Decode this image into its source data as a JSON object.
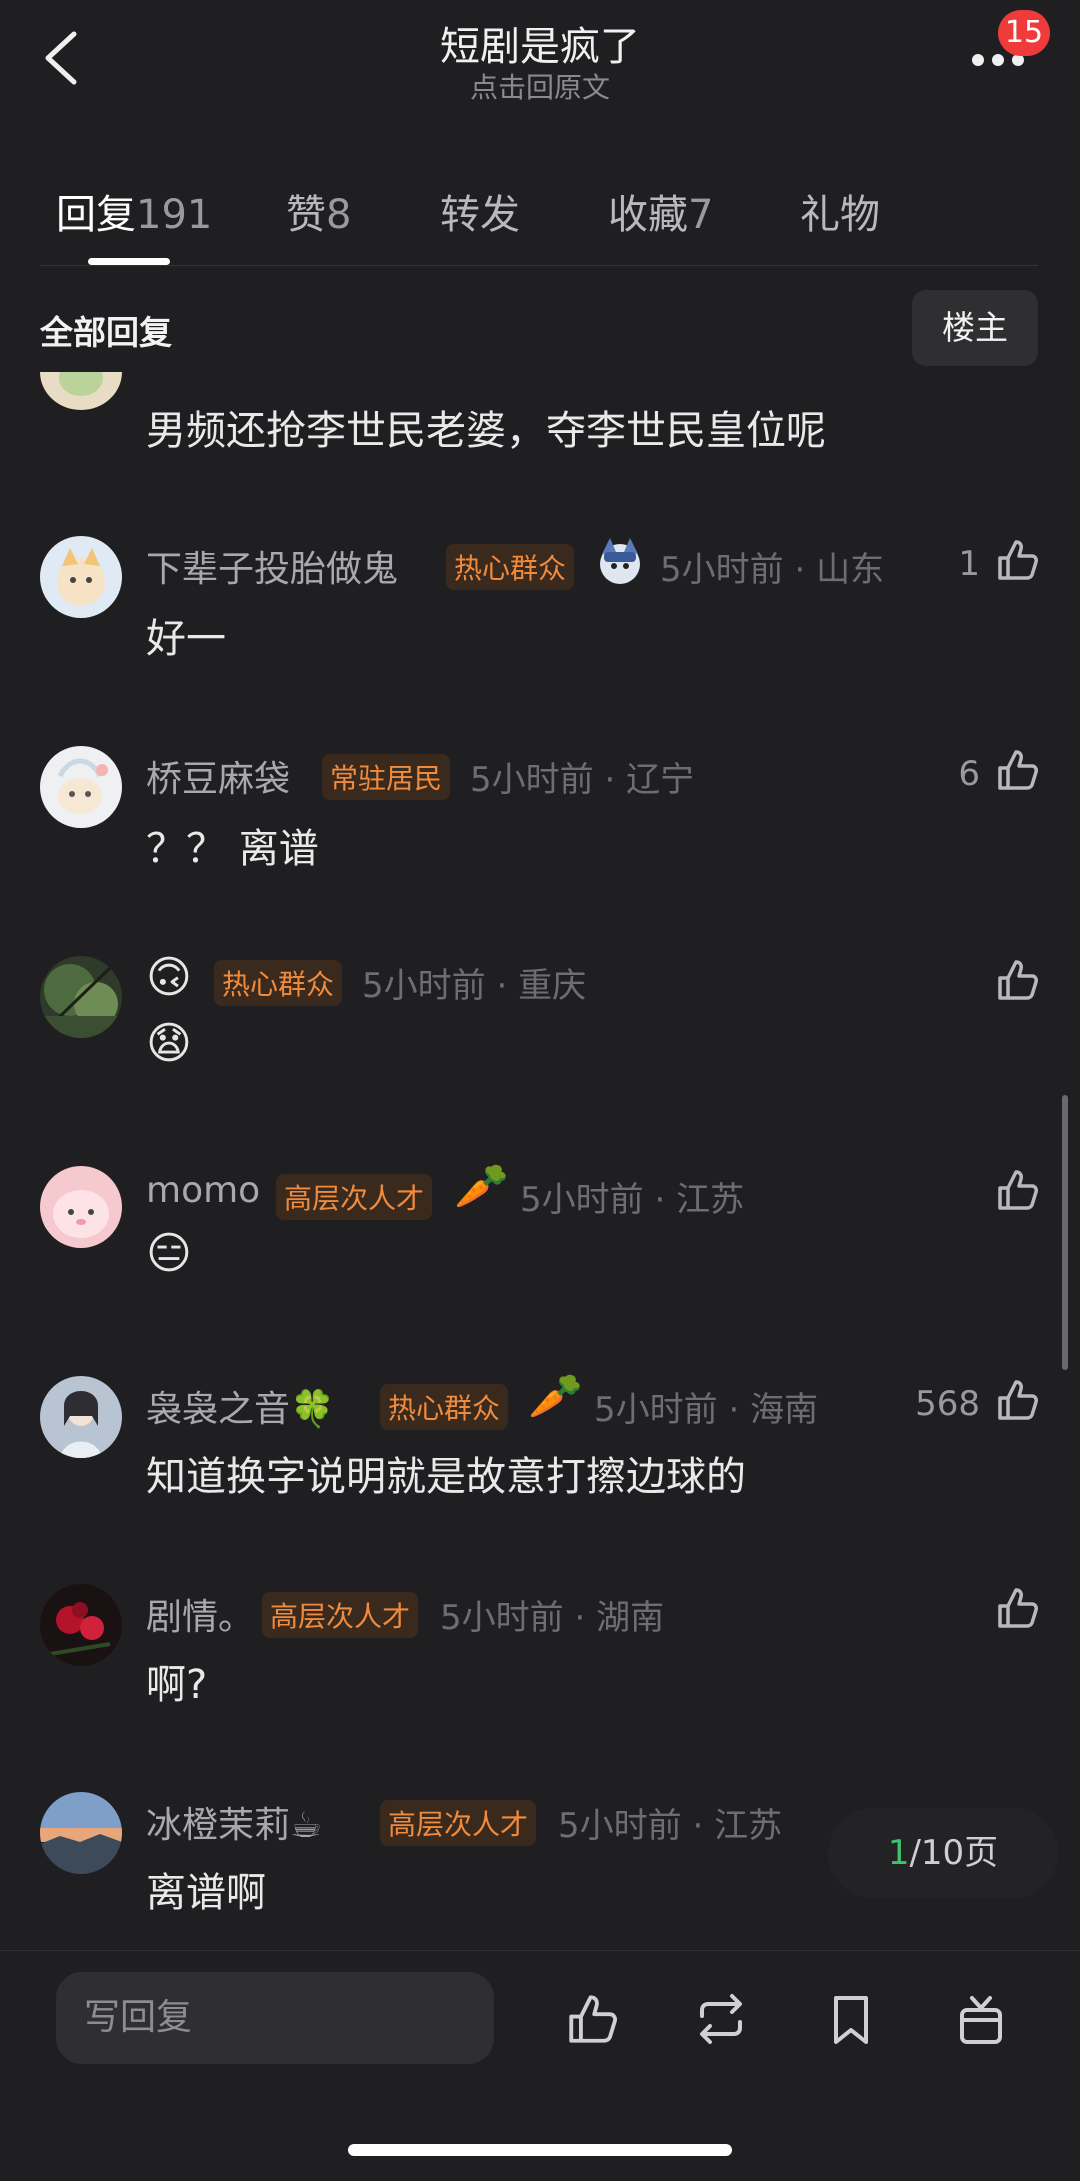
{
  "header": {
    "title": "短剧是疯了",
    "subtitle": "点击回原文",
    "notification_badge": "15"
  },
  "tabs": [
    {
      "label": "回复",
      "count": "191",
      "active": true
    },
    {
      "label": "赞",
      "count": "8",
      "active": false
    },
    {
      "label": "转发",
      "count": "",
      "active": false
    },
    {
      "label": "收藏",
      "count": "7",
      "active": false
    },
    {
      "label": "礼物",
      "count": "",
      "active": false
    }
  ],
  "filter": {
    "all_replies": "全部回复",
    "op_only": "楼主"
  },
  "partial_comment": {
    "content": "男频还抢李世民老婆，夺李世民皇位呢"
  },
  "comments": [
    {
      "username": "下辈子投胎做鬼",
      "tag": "热心群众",
      "time": "5小时前",
      "location": "山东",
      "content": "好一",
      "likes": "1"
    },
    {
      "username": "桥豆麻袋",
      "tag": "常驻居民",
      "time": "5小时前",
      "location": "辽宁",
      "content": "？？ 离谱",
      "likes": "6"
    },
    {
      "username": "🙃",
      "tag": "热心群众",
      "time": "5小时前",
      "location": "重庆",
      "content": "😧",
      "likes": ""
    },
    {
      "username": "momo",
      "tag": "高层次人才",
      "time": "5小时前",
      "location": "江苏",
      "content": "😑",
      "likes": ""
    },
    {
      "username": "袅袅之音",
      "username_emoji": "🍀",
      "tag": "热心群众",
      "time": "5小时前",
      "location": "海南",
      "content": "知道换字说明就是故意打擦边球的",
      "likes": "568"
    },
    {
      "username": "剧情。",
      "tag": "高层次人才",
      "time": "5小时前",
      "location": "湖南",
      "content": "啊?",
      "likes": ""
    },
    {
      "username": "冰橙茉莉",
      "username_emoji": "☕",
      "tag": "高层次人才",
      "time": "5小时前",
      "location": "江苏",
      "content": "离谱啊",
      "likes": ""
    }
  ],
  "decorations": {
    "carrot": "🥕"
  },
  "pagination": {
    "current": "1",
    "total_text": "/10页"
  },
  "bottom_bar": {
    "reply_placeholder": "写回复"
  },
  "colors": {
    "background": "#1f1f21",
    "tag_text": "#f08a3c",
    "tag_bg": "#3a2a1e",
    "badge": "#f03b3b",
    "page_current": "#3ec46d"
  }
}
